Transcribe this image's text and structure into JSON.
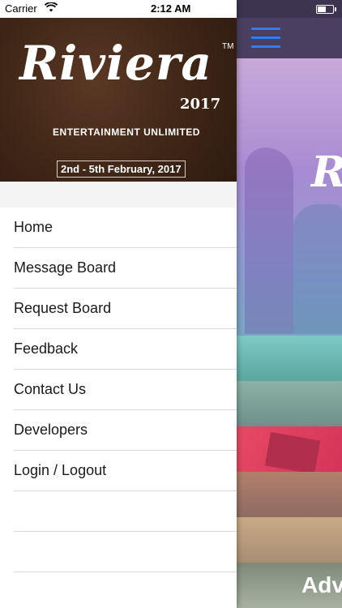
{
  "status_bar": {
    "carrier": "Carrier",
    "time": "2:12 AM",
    "wifi_icon": "wifi-icon",
    "battery_icon": "battery-icon"
  },
  "banner": {
    "logo": "Riviera",
    "trademark": "TM",
    "year": "2017",
    "tagline": "ENTERTAINMENT UNLIMITED",
    "dates": "2nd - 5th February, 2017"
  },
  "menu": {
    "items": [
      {
        "label": "Home"
      },
      {
        "label": "Message Board"
      },
      {
        "label": "Request Board"
      },
      {
        "label": "Feedback"
      },
      {
        "label": "Contact Us"
      },
      {
        "label": "Developers"
      },
      {
        "label": "Login / Logout"
      }
    ]
  },
  "background_app": {
    "menu_icon": "hamburger-menu-icon",
    "hero_logo_fragment": "R",
    "partial_heading": "Adv",
    "colors": {
      "navbar": "#4a3f61",
      "hamburger": "#2f7df6"
    }
  }
}
